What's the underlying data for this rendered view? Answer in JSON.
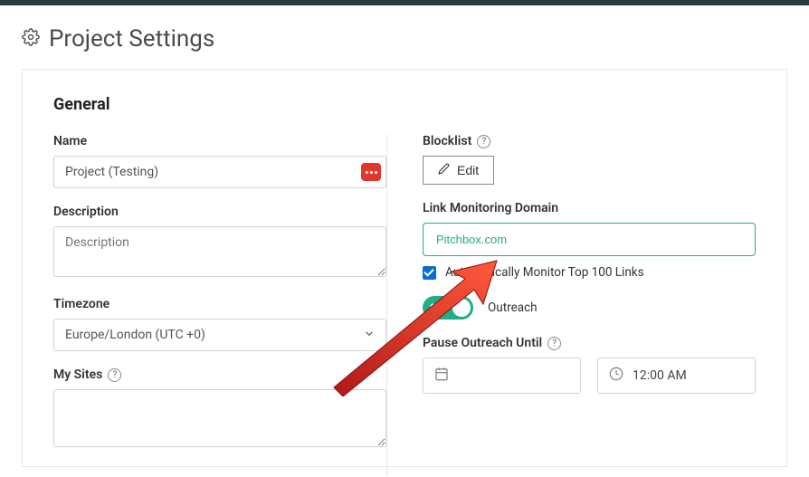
{
  "page": {
    "title": "Project Settings"
  },
  "section": {
    "title": "General"
  },
  "name": {
    "label": "Name",
    "value": "Project (Testing)"
  },
  "description": {
    "label": "Description",
    "placeholder": "Description"
  },
  "timezone": {
    "label": "Timezone",
    "value": "Europe/London (UTC +0)"
  },
  "mysites": {
    "label": "My Sites"
  },
  "blocklist": {
    "label": "Blocklist",
    "edit": "Edit"
  },
  "monitoring": {
    "label": "Link Monitoring Domain",
    "value": "Pitchbox.com",
    "auto_label": "Automatically Monitor Top 100 Links"
  },
  "outreach": {
    "toggle_label": "ON",
    "label": "Outreach"
  },
  "pause": {
    "label": "Pause Outreach Until",
    "time": "12:00 AM"
  }
}
